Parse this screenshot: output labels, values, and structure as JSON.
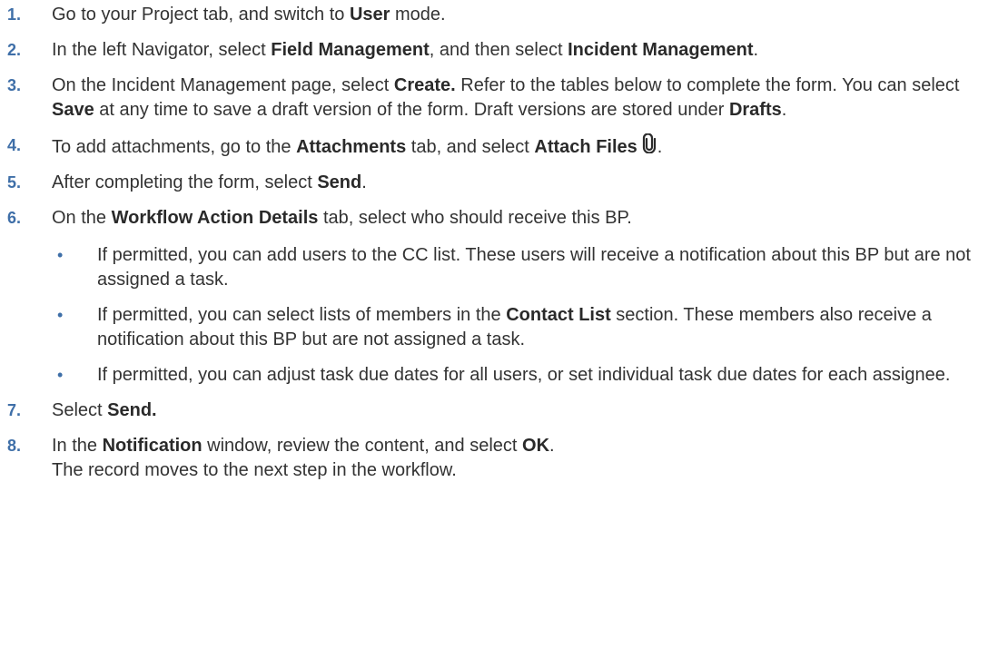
{
  "steps": [
    {
      "number": "1.",
      "parts": [
        {
          "t": "Go to your Project tab, and switch to "
        },
        {
          "t": "User",
          "b": true
        },
        {
          "t": " mode."
        }
      ]
    },
    {
      "number": "2.",
      "parts": [
        {
          "t": "In the left Navigator, select "
        },
        {
          "t": "Field Management",
          "b": true
        },
        {
          "t": ", and then select "
        },
        {
          "t": "Incident Management",
          "b": true
        },
        {
          "t": "."
        }
      ]
    },
    {
      "number": "3.",
      "parts": [
        {
          "t": "On the Incident Management page, select "
        },
        {
          "t": "Create.",
          "b": true
        },
        {
          "t": " Refer to the tables below to complete the form. You can select "
        },
        {
          "t": "Save",
          "b": true
        },
        {
          "t": " at any time to save a draft version of the form. Draft versions are stored under "
        },
        {
          "t": "Drafts",
          "b": true
        },
        {
          "t": "."
        }
      ]
    },
    {
      "number": "4.",
      "parts": [
        {
          "t": "To add attachments, go to the "
        },
        {
          "t": "Attachments",
          "b": true
        },
        {
          "t": " tab, and select "
        },
        {
          "t": "Attach Files",
          "b": true
        },
        {
          "icon": "paperclip-icon"
        },
        {
          "t": "."
        }
      ]
    },
    {
      "number": "5.",
      "parts": [
        {
          "t": "After completing the form, select "
        },
        {
          "t": "Send",
          "b": true
        },
        {
          "t": "."
        }
      ]
    },
    {
      "number": "6.",
      "parts": [
        {
          "t": "On the "
        },
        {
          "t": "Workflow Action Details",
          "b": true
        },
        {
          "t": " tab, select who should receive this BP."
        }
      ],
      "bullets": [
        {
          "bullet": "•",
          "parts": [
            {
              "t": "If permitted, you can add users to the CC list. These users will receive a notification about this BP but are not assigned a task."
            }
          ]
        },
        {
          "bullet": "•",
          "parts": [
            {
              "t": "If permitted, you can select lists of members in the "
            },
            {
              "t": "Contact List",
              "b": true
            },
            {
              "t": " section. These members also receive a notification about this BP but are not assigned a task."
            }
          ]
        },
        {
          "bullet": "•",
          "parts": [
            {
              "t": "If permitted, you can adjust task due dates for all users, or set individual task due dates for each assignee."
            }
          ]
        }
      ]
    },
    {
      "number": "7.",
      "parts": [
        {
          "t": "Select "
        },
        {
          "t": "Send.",
          "b": true
        }
      ]
    },
    {
      "number": "8.",
      "parts": [
        {
          "t": "In the "
        },
        {
          "t": "Notification",
          "b": true
        },
        {
          "t": " window, review the content, and select "
        },
        {
          "t": "OK",
          "b": true
        },
        {
          "t": "."
        }
      ],
      "result": "The record moves to the next step in the workflow."
    }
  ]
}
